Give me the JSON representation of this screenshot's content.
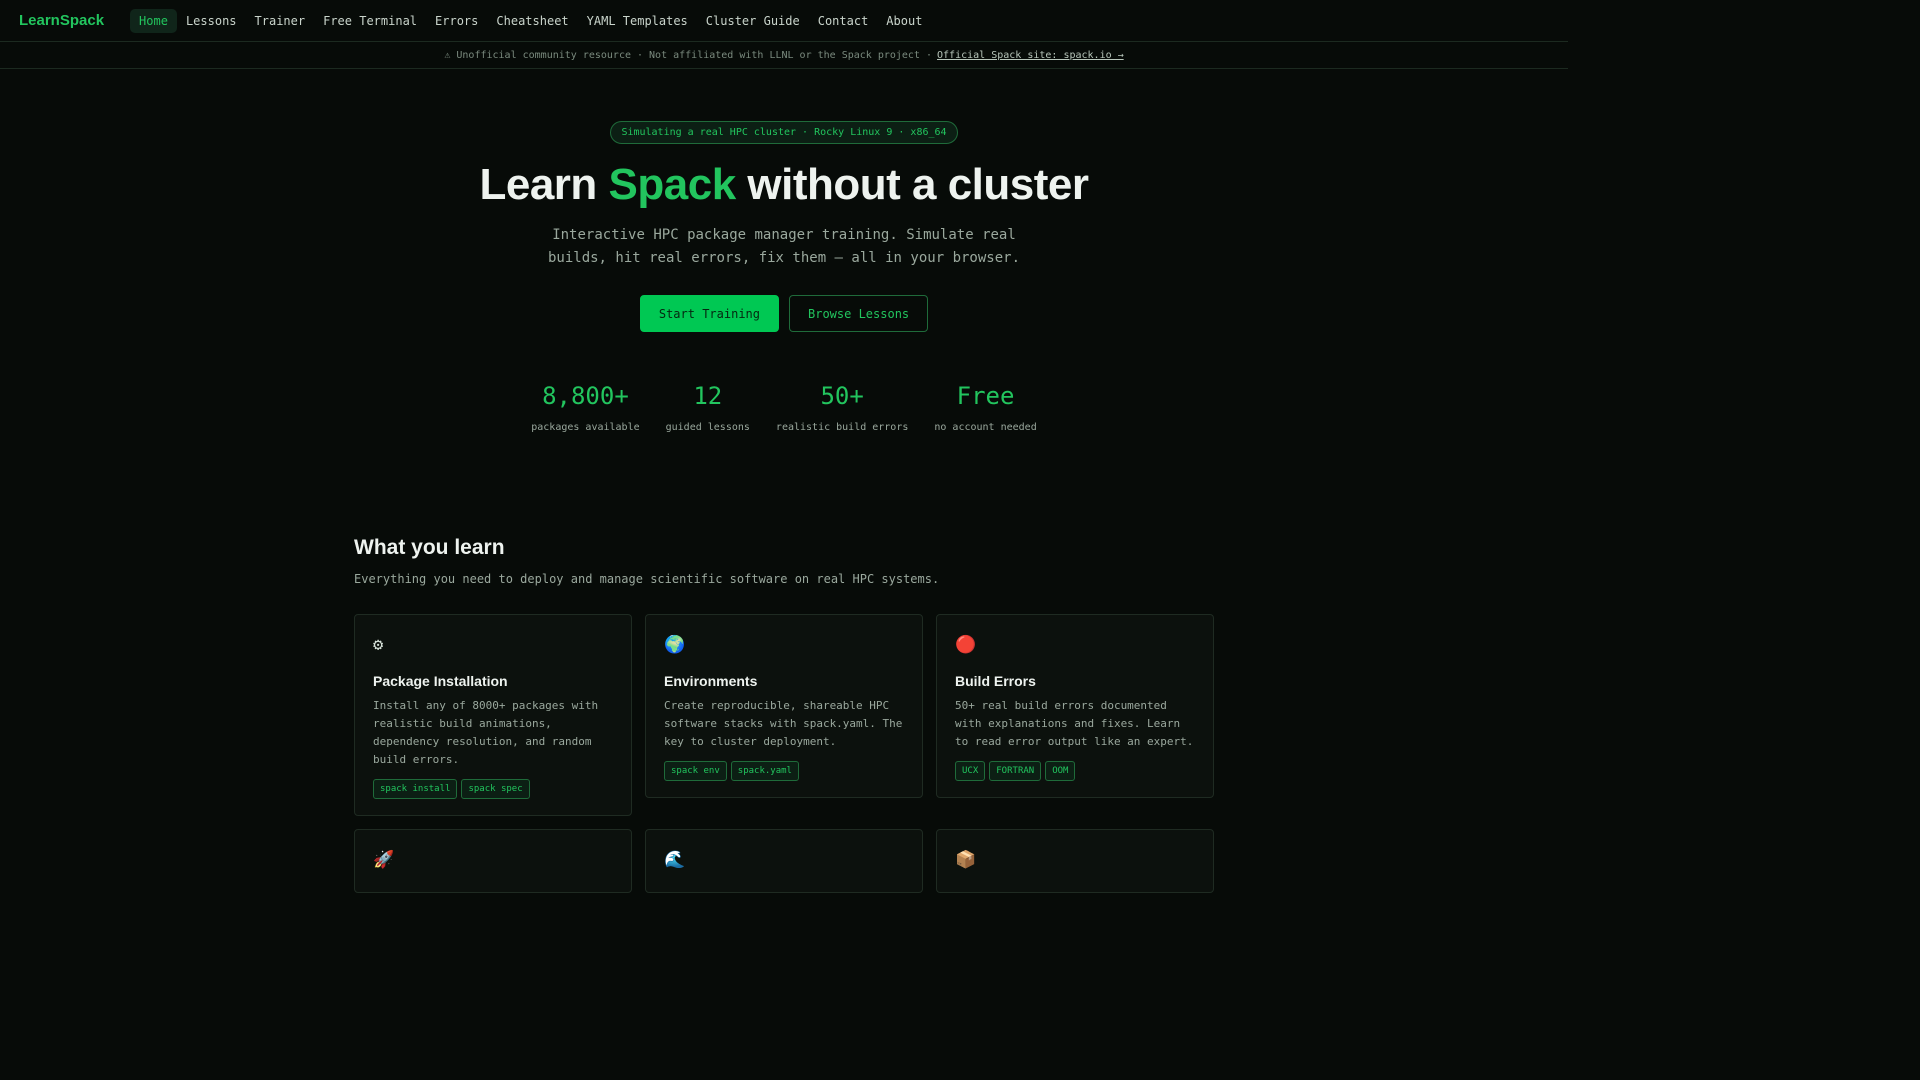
{
  "nav": {
    "brand": "LearnSpack",
    "items": [
      {
        "label": "Home",
        "active": true
      },
      {
        "label": "Lessons"
      },
      {
        "label": "Trainer"
      },
      {
        "label": "Free Terminal"
      },
      {
        "label": "Errors"
      },
      {
        "label": "Cheatsheet"
      },
      {
        "label": "YAML Templates"
      },
      {
        "label": "Cluster Guide"
      },
      {
        "label": "Contact"
      },
      {
        "label": "About"
      }
    ]
  },
  "disclaimer": {
    "text": "⚠ Unofficial community resource · Not affiliated with LLNL or the Spack project ·",
    "link": "Official Spack site: spack.io →"
  },
  "hero": {
    "badge": "Simulating a real HPC cluster · Rocky Linux 9 · x86_64",
    "title_pre": "Learn ",
    "title_accent": "Spack",
    "title_post": " without a cluster",
    "subtitle": "Interactive HPC package manager training. Simulate real builds, hit real errors, fix them — all in your browser.",
    "primary_cta": "Start Training",
    "secondary_cta": "Browse Lessons"
  },
  "stats": [
    {
      "value": "8,800+",
      "label": "packages available"
    },
    {
      "value": "12",
      "label": "guided lessons"
    },
    {
      "value": "50+",
      "label": "realistic build errors"
    },
    {
      "value": "Free",
      "label": "no account needed"
    }
  ],
  "features": {
    "title": "What you learn",
    "subtitle": "Everything you need to deploy and manage scientific software on real HPC systems.",
    "cards": [
      {
        "icon": "⚙",
        "icon_name": "gear-icon",
        "title": "Package Installation",
        "description": "Install any of 8000+ packages with realistic build animations, dependency resolution, and random build errors.",
        "tags": [
          "spack install",
          "spack spec"
        ]
      },
      {
        "icon": "🌍",
        "icon_name": "globe-icon",
        "title": "Environments",
        "description": "Create reproducible, shareable HPC software stacks with spack.yaml. The key to cluster deployment.",
        "tags": [
          "spack env",
          "spack.yaml"
        ]
      },
      {
        "icon": "🔴",
        "icon_name": "red-circle-icon",
        "title": "Build Errors",
        "description": "50+ real build errors documented with explanations and fixes. Learn to read error output like an expert.",
        "tags": [
          "UCX",
          "FORTRAN",
          "OOM"
        ]
      },
      {
        "icon": "🚀",
        "icon_name": "rocket-icon",
        "title": "",
        "description": "",
        "tags": []
      },
      {
        "icon": "🌊",
        "icon_name": "wave-icon",
        "title": "",
        "description": "",
        "tags": []
      },
      {
        "icon": "📦",
        "icon_name": "package-icon",
        "title": "",
        "description": "",
        "tags": []
      }
    ]
  },
  "colors": {
    "background": "#070b08",
    "accent": "#22c55e",
    "primary_button": "#00c853"
  }
}
